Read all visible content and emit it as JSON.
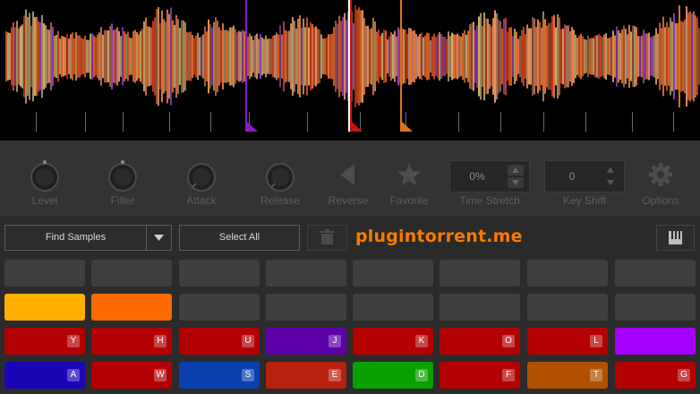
{
  "waveform": {
    "playhead_color": "#ffffff",
    "markers": [
      {
        "color": "#8a19c8"
      },
      {
        "color": "#c41414"
      },
      {
        "color": "#d8751c"
      }
    ],
    "palette": [
      "#e25a20",
      "#f07a30",
      "#c43e1c",
      "#b8a060",
      "#cfb070",
      "#e07040",
      "#9a40b0",
      "#d08a70",
      "#e89a60",
      "#a06040"
    ]
  },
  "controls": {
    "level": {
      "label": "Level",
      "icon": "knob-icon"
    },
    "filter": {
      "label": "Filter",
      "icon": "knob-icon"
    },
    "attack": {
      "label": "Attack",
      "icon": "knob-icon"
    },
    "release": {
      "label": "Release",
      "icon": "knob-icon"
    },
    "reverse": {
      "label": "Reverse",
      "icon": "reverse-triangle-icon"
    },
    "favorite": {
      "label": "Favorite",
      "icon": "star-icon"
    },
    "time_stretch": {
      "label": "Time Stretch",
      "value": "0%"
    },
    "key_shift": {
      "label": "Key Shift",
      "value": "0"
    },
    "options": {
      "label": "Options",
      "icon": "gear-icon"
    }
  },
  "toolbar": {
    "find_samples": "Find Samples",
    "dropdown_icon": "chevron-down-icon",
    "select_all": "Select All",
    "delete_icon": "trash-icon",
    "keyboard_icon": "piano-keys-icon"
  },
  "watermark": "plugintorrent.me",
  "pads": {
    "rows": [
      [
        {
          "color": "#3f3f3f",
          "key": ""
        },
        {
          "color": "#3f3f3f",
          "key": ""
        },
        {
          "color": "#3f3f3f",
          "key": ""
        },
        {
          "color": "#3f3f3f",
          "key": ""
        },
        {
          "color": "#3f3f3f",
          "key": ""
        },
        {
          "color": "#3f3f3f",
          "key": ""
        },
        {
          "color": "#3f3f3f",
          "key": ""
        },
        {
          "color": "#3f3f3f",
          "key": ""
        }
      ],
      [
        {
          "color": "#ffb000",
          "key": ""
        },
        {
          "color": "#ff6a00",
          "key": ""
        },
        {
          "color": "#3f3f3f",
          "key": ""
        },
        {
          "color": "#3f3f3f",
          "key": ""
        },
        {
          "color": "#3f3f3f",
          "key": ""
        },
        {
          "color": "#3f3f3f",
          "key": ""
        },
        {
          "color": "#3f3f3f",
          "key": ""
        },
        {
          "color": "#3f3f3f",
          "key": ""
        }
      ],
      [
        {
          "color": "#b30000",
          "key": "Y"
        },
        {
          "color": "#b30000",
          "key": "H"
        },
        {
          "color": "#b30000",
          "key": "U"
        },
        {
          "color": "#5c00a8",
          "key": "J"
        },
        {
          "color": "#b30000",
          "key": "K"
        },
        {
          "color": "#b30000",
          "key": "O"
        },
        {
          "color": "#b30000",
          "key": "L"
        },
        {
          "color": "#a400ff",
          "key": ""
        }
      ],
      [
        {
          "color": "#1a06b5",
          "key": "A"
        },
        {
          "color": "#b30000",
          "key": "W"
        },
        {
          "color": "#0a3fb0",
          "key": "S"
        },
        {
          "color": "#b82010",
          "key": "E"
        },
        {
          "color": "#0aa000",
          "key": "D"
        },
        {
          "color": "#b30000",
          "key": "F"
        },
        {
          "color": "#b05000",
          "key": "T"
        },
        {
          "color": "#b30000",
          "key": "G"
        }
      ]
    ]
  }
}
